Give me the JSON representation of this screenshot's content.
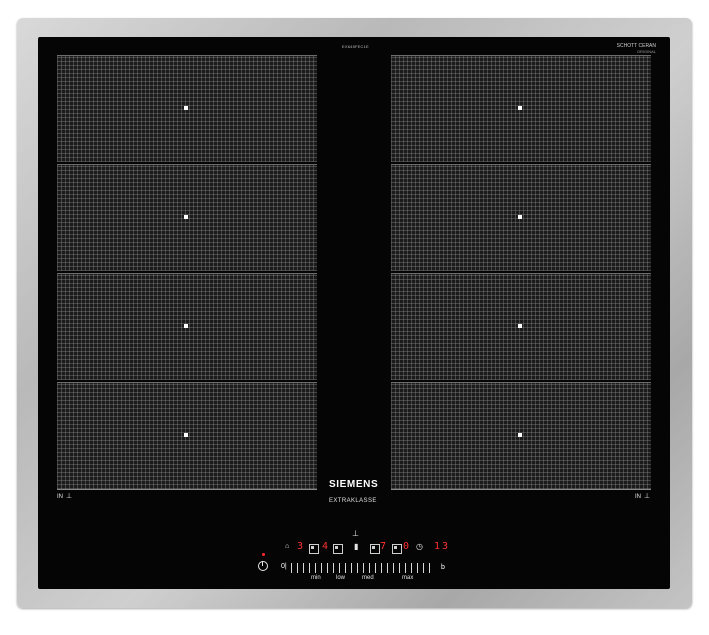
{
  "hob": {
    "model_code": "EX645FEC1E",
    "glass_brand": "SCHOTT CERAN",
    "glass_sub": "ORIGINAL",
    "brand": "SIEMENS",
    "line": "EXTRAKLASSE",
    "left_in_label": "IN",
    "right_in_label": "IN",
    "in_icon": "induction-icon"
  },
  "controls": {
    "zone1_level": "3",
    "zone2_level": "4",
    "zone3_level": "7",
    "zone4_level": "0",
    "timer_display": "13",
    "slider_start": "0|",
    "slider_labels": [
      "min",
      "low",
      "med",
      "max"
    ],
    "boost_label": "b",
    "info_label": "i"
  },
  "colors": {
    "glass": "#050505",
    "display_red": "#ff3030",
    "frame": "#c0c0c0"
  }
}
